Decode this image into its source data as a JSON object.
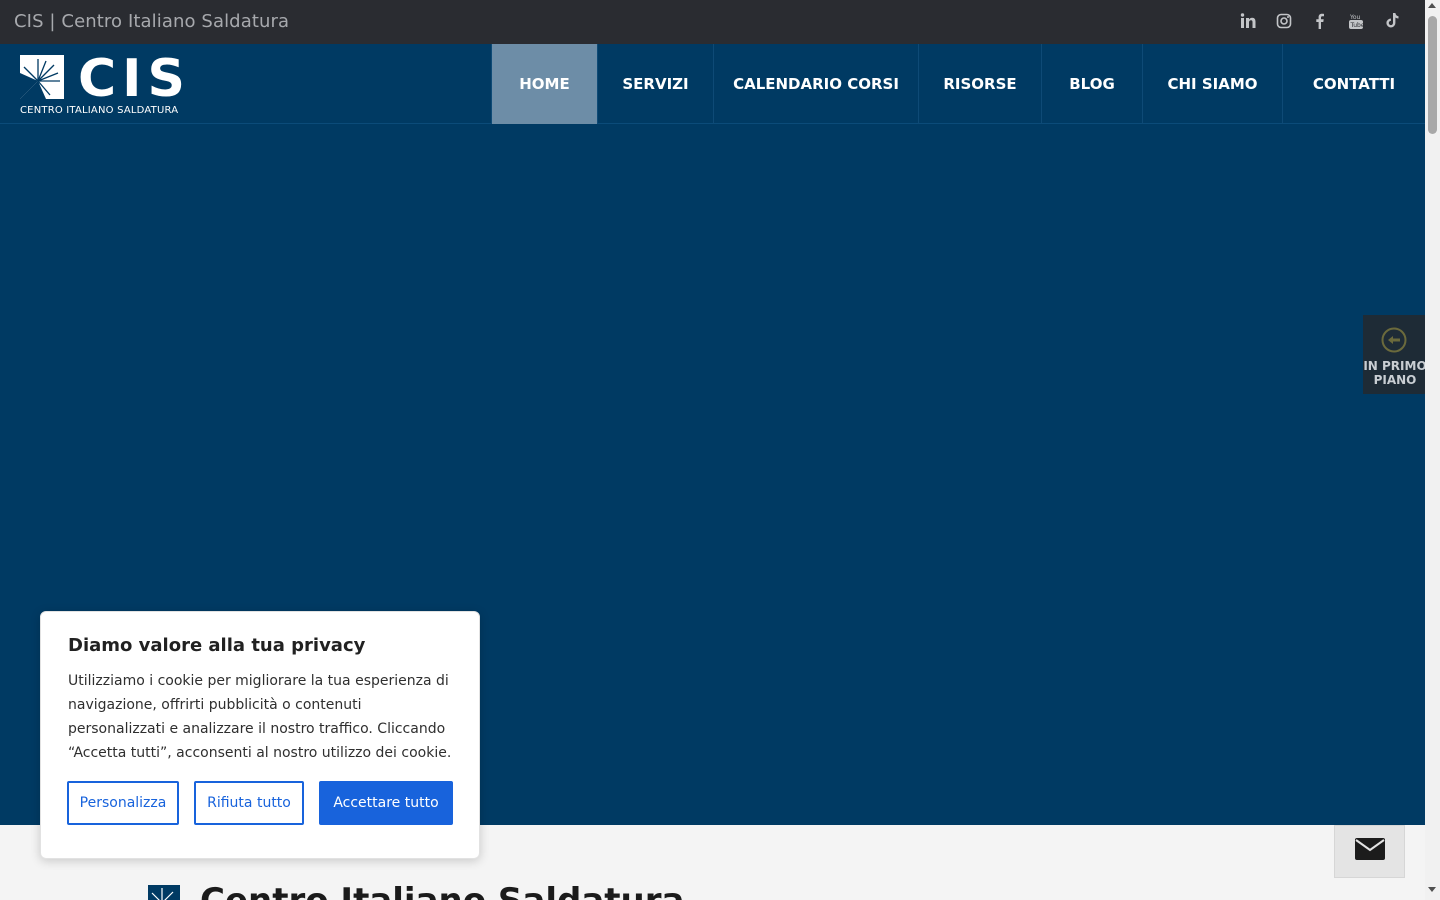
{
  "topbar": {
    "title": "CIS | Centro Italiano Saldatura",
    "socials": [
      "linkedin-icon",
      "instagram-icon",
      "facebook-icon",
      "youtube-icon",
      "tiktok-icon"
    ]
  },
  "logo": {
    "text": "CIS",
    "subtitle": "CENTRO ITALIANO SALDATURA"
  },
  "nav": {
    "items": [
      {
        "label": "HOME"
      },
      {
        "label": "SERVIZI"
      },
      {
        "label": "CALENDARIO CORSI"
      },
      {
        "label": "RISORSE"
      },
      {
        "label": "BLOG"
      },
      {
        "label": "CHI SIAMO"
      },
      {
        "label": "CONTATTI"
      }
    ]
  },
  "sidetab": {
    "label": "IN PRIMO PIANO",
    "icon": "arrow-left-circle-icon"
  },
  "section": {
    "title": "Centro Italiano Saldatura"
  },
  "cookie": {
    "title": "Diamo valore alla tua privacy",
    "text": "Utilizziamo i cookie per migliorare la tua esperienza di navigazione, offrirti pubblicità o contenuti personalizzati e analizzare il nostro traffico. Cliccando “Accetta tutti”, acconsenti al nostro utilizzo dei cookie.",
    "customize_label": "Personalizza",
    "reject_label": "Rifiuta tutto",
    "accept_label": "Accettare tutto"
  },
  "colors": {
    "brand": "#003a63",
    "topbar": "#2a2c31",
    "active_nav": "#6d8da7",
    "cookie_accent": "#1863dc"
  }
}
